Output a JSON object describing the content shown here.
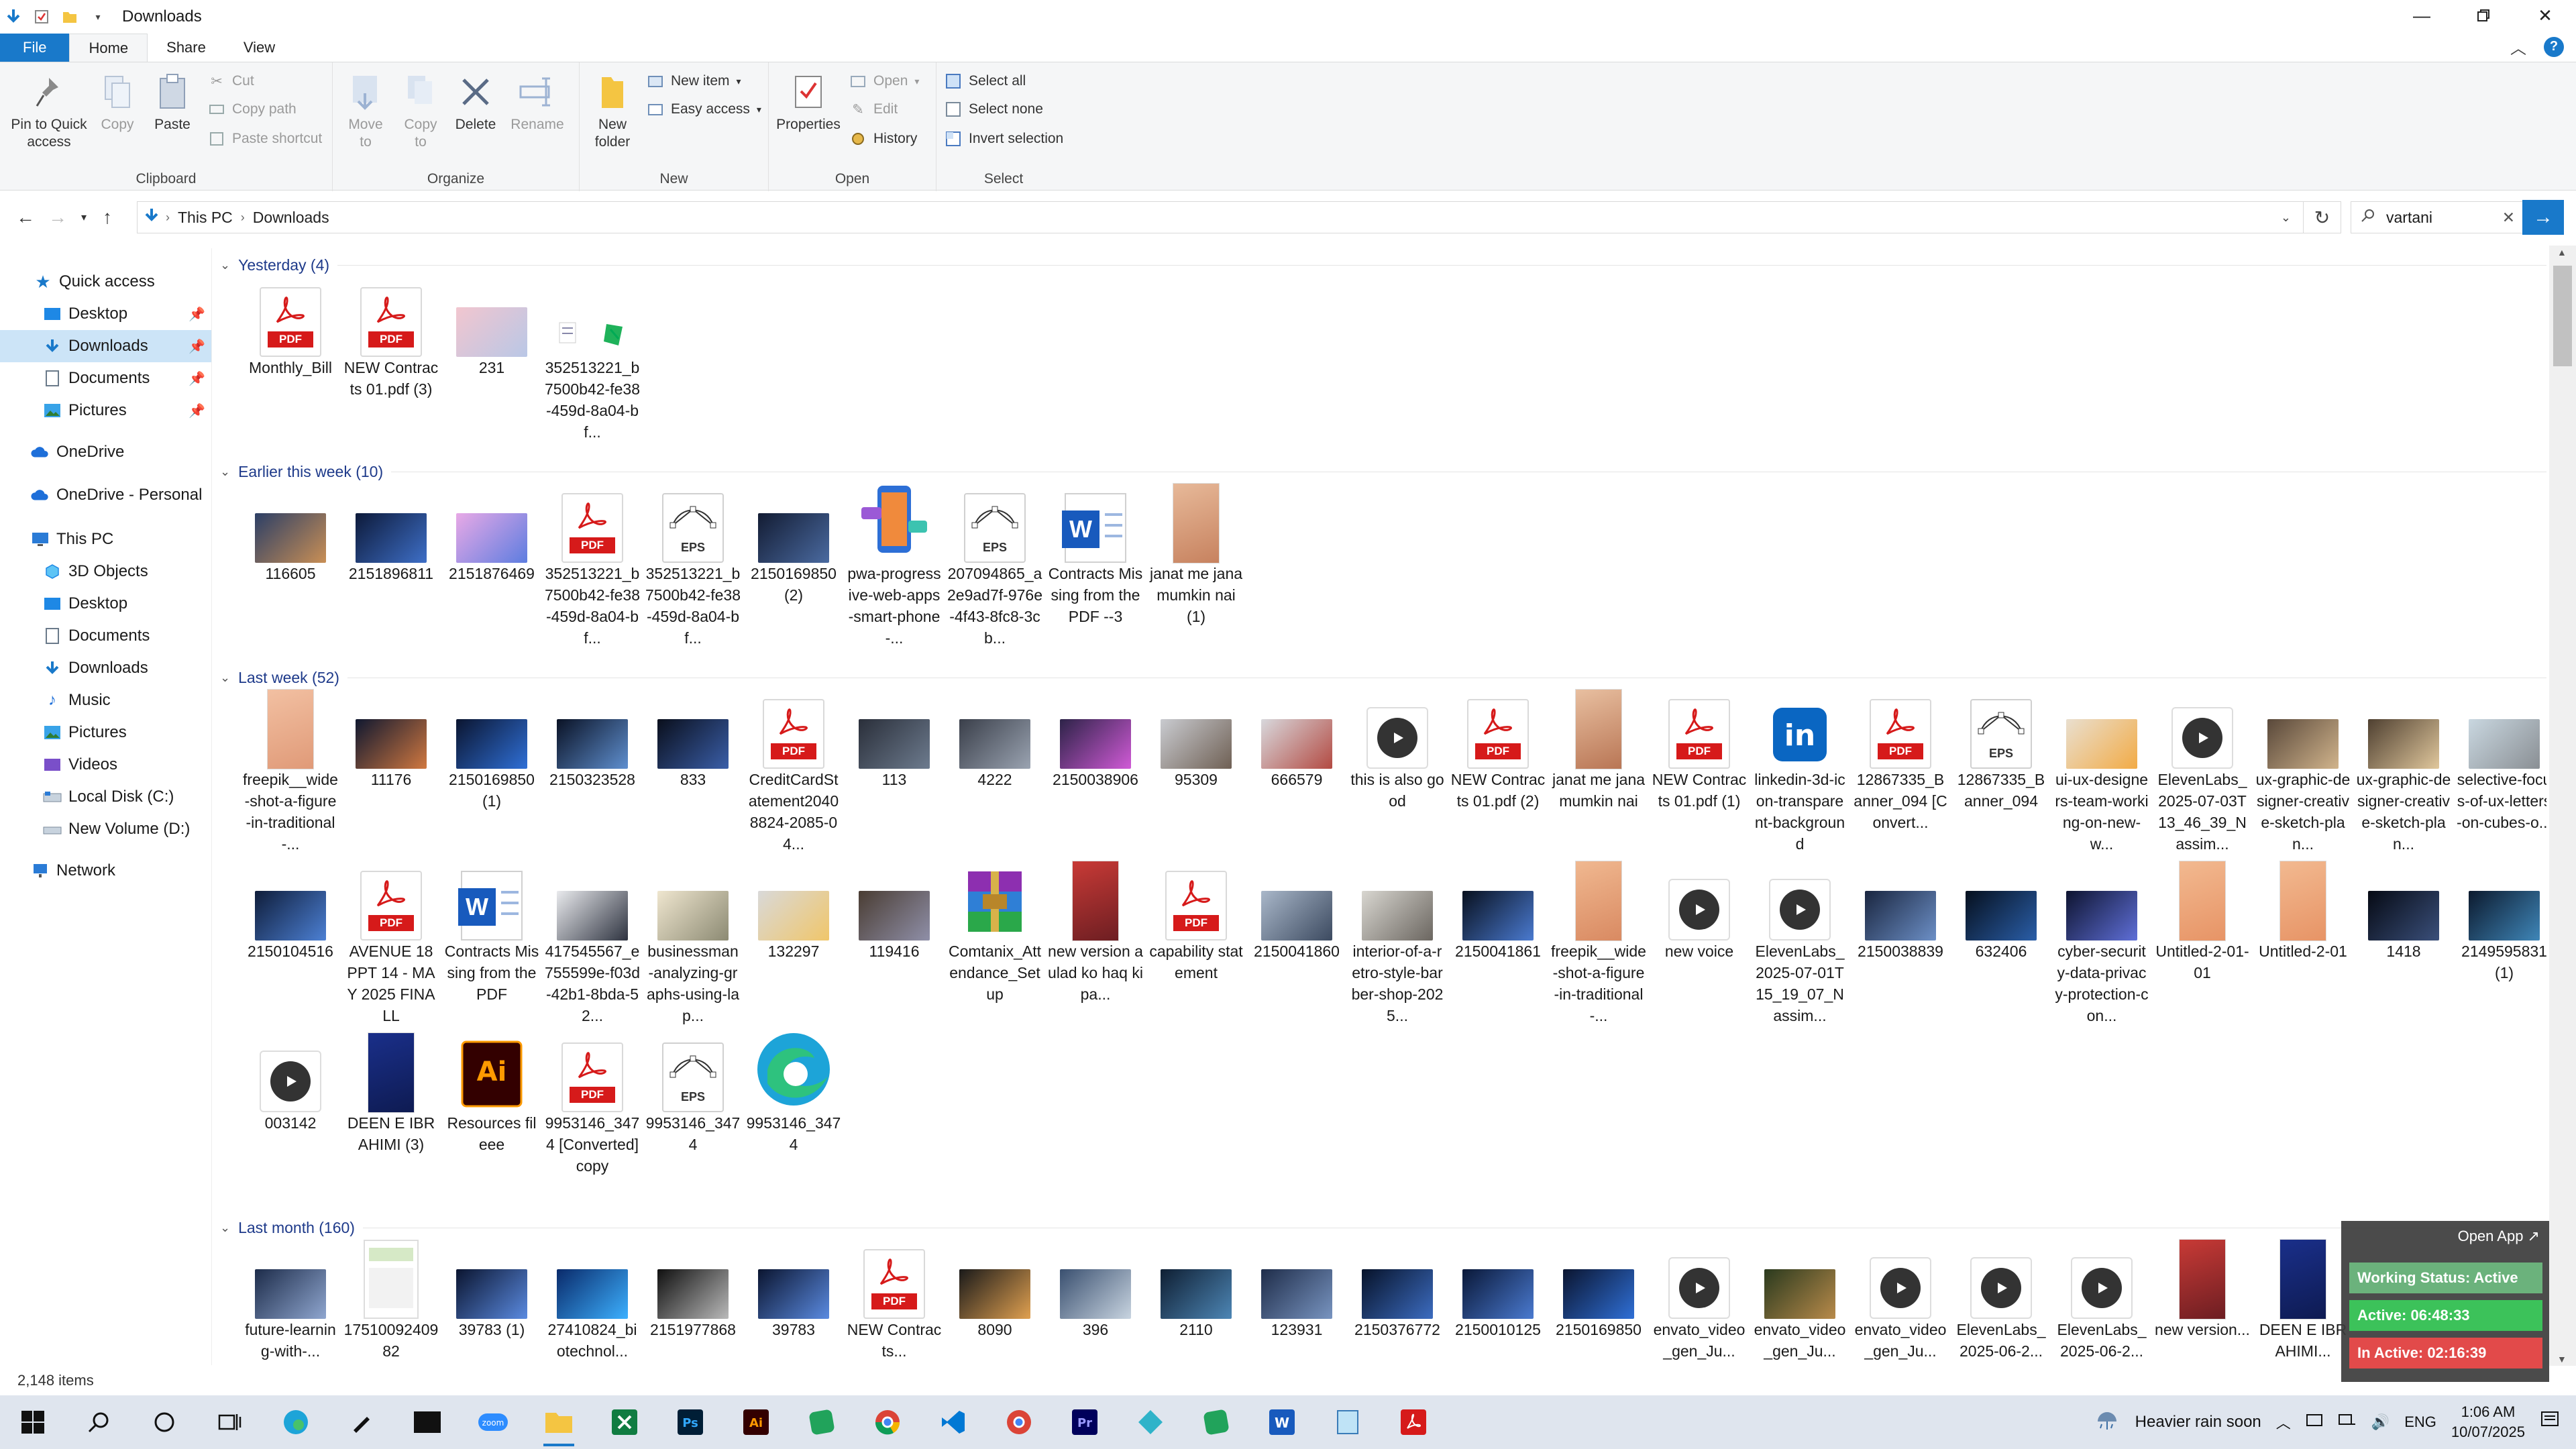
{
  "window": {
    "title": "Downloads"
  },
  "ribbon_tabs": [
    "File",
    "Home",
    "Share",
    "View"
  ],
  "ribbon": {
    "clipboard": {
      "label": "Clipboard",
      "pin": "Pin to Quick access",
      "copy": "Copy",
      "paste": "Paste",
      "cut": "Cut",
      "copy_path": "Copy path",
      "paste_shortcut": "Paste shortcut"
    },
    "organize": {
      "label": "Organize",
      "move_to": "Move to",
      "copy_to": "Copy to",
      "delete": "Delete",
      "rename": "Rename"
    },
    "new": {
      "label": "New",
      "new_folder": "New folder",
      "new_item": "New item",
      "easy_access": "Easy access"
    },
    "open": {
      "label": "Open",
      "properties": "Properties",
      "open": "Open",
      "edit": "Edit",
      "history": "History"
    },
    "select": {
      "label": "Select",
      "select_all": "Select all",
      "select_none": "Select none",
      "invert": "Invert selection"
    }
  },
  "address": {
    "path": [
      "This PC",
      "Downloads"
    ],
    "search_value": "vartani"
  },
  "nav": {
    "quick_access": "Quick access",
    "quick_items": [
      "Desktop",
      "Downloads",
      "Documents",
      "Pictures"
    ],
    "onedrive": "OneDrive",
    "onedrive_personal": "OneDrive - Personal",
    "this_pc": "This PC",
    "pc_items": [
      "3D Objects",
      "Desktop",
      "Documents",
      "Downloads",
      "Music",
      "Pictures",
      "Videos",
      "Local Disk (C:)",
      "New Volume (D:)"
    ],
    "network": "Network"
  },
  "groups": [
    {
      "title": "Yesterday (4)",
      "rows": [
        [
          {
            "kind": "pdf",
            "label": "Monthly_Bill"
          },
          {
            "kind": "pdf",
            "label": "NEW Contracts 01.pdf (3)"
          },
          {
            "kind": "photo",
            "c1": "#f2c6cf",
            "c2": "#b9c7e6",
            "label": "231"
          },
          {
            "kind": "sheet",
            "label": "352513221_b7500b42-fe38-459d-8a04-bf..."
          }
        ]
      ]
    },
    {
      "title": "Earlier this week (10)",
      "rows": [
        [
          {
            "kind": "photo",
            "c1": "#2c3f66",
            "c2": "#c98f55",
            "label": "116605"
          },
          {
            "kind": "photo",
            "c1": "#0d1a3a",
            "c2": "#3e6fc7",
            "label": "2151896811"
          },
          {
            "kind": "photo",
            "c1": "#e8a9e6",
            "c2": "#5d7de0",
            "label": "2151876469"
          },
          {
            "kind": "pdf",
            "label": "352513221_b7500b42-fe38-459d-8a04-bf..."
          },
          {
            "kind": "eps",
            "label": "352513221_b7500b42-fe38-459d-8a04-bf..."
          },
          {
            "kind": "photo",
            "c1": "#131c33",
            "c2": "#4a6aa0",
            "label": "2150169850 (2)"
          },
          {
            "kind": "phone",
            "label": "pwa-progressive-web-apps-smart-phone-..."
          },
          {
            "kind": "eps",
            "label": "207094865_a2e9ad7f-976e-4f43-8fc8-3cb..."
          },
          {
            "kind": "word",
            "label": "Contracts Missing from the PDF --3"
          },
          {
            "kind": "book",
            "c1": "#e7b999",
            "c2": "#c7825f",
            "label": "janat me jana mumkin nai (1)"
          }
        ]
      ]
    },
    {
      "title": "Last week (52)",
      "rows": [
        [
          {
            "kind": "book",
            "c1": "#f2c0a2",
            "c2": "#e09a78",
            "label": "freepik__wide-shot-a-figure-in-traditional-..."
          },
          {
            "kind": "photo",
            "c1": "#101830",
            "c2": "#d07840",
            "label": "11176"
          },
          {
            "kind": "photo",
            "c1": "#0b1530",
            "c2": "#2f6fd6",
            "label": "2150169850 (1)"
          },
          {
            "kind": "photo",
            "c1": "#0a1225",
            "c2": "#5f8fcf",
            "label": "2150323528"
          },
          {
            "kind": "photo",
            "c1": "#0a0f1c",
            "c2": "#3a5ea8",
            "label": "833"
          },
          {
            "kind": "pdf",
            "label": "CreditCardStatement20408824-2085-04..."
          },
          {
            "kind": "photo",
            "c1": "#2a2f3a",
            "c2": "#6d7b8e",
            "label": "113"
          },
          {
            "kind": "photo",
            "c1": "#3a3f4a",
            "c2": "#9aa3b1",
            "label": "4222"
          },
          {
            "kind": "photo",
            "c1": "#2d2348",
            "c2": "#d05ad6",
            "label": "2150038906"
          },
          {
            "kind": "photo",
            "c1": "#c9cbd0",
            "c2": "#6f6054",
            "label": "95309"
          },
          {
            "kind": "photo",
            "c1": "#d8d8dc",
            "c2": "#b34a42",
            "label": "666579"
          },
          {
            "kind": "video",
            "label": "this is also good"
          },
          {
            "kind": "pdf",
            "label": "NEW Contracts 01.pdf (2)"
          },
          {
            "kind": "book",
            "c1": "#e8bfa0",
            "c2": "#b97655",
            "label": "janat me jana mumkin nai"
          },
          {
            "kind": "pdf",
            "label": "NEW Contracts 01.pdf (1)"
          },
          {
            "kind": "linkedin",
            "label": "linkedin-3d-icon-transparent-background"
          },
          {
            "kind": "pdf",
            "label": "12867335_Banner_094 [Convert..."
          },
          {
            "kind": "eps",
            "label": "12867335_Banner_094"
          },
          {
            "kind": "photo",
            "c1": "#e9dfcf",
            "c2": "#f2ab46",
            "label": "ui-ux-designers-team-working-on-new-w..."
          },
          {
            "kind": "video",
            "label": "ElevenLabs_2025-07-03T13_46_39_Nassim..."
          },
          {
            "kind": "photo",
            "c1": "#59483a",
            "c2": "#d1b48c",
            "label": "ux-graphic-designer-creative-sketch-plan..."
          },
          {
            "kind": "photo",
            "c1": "#4f4031",
            "c2": "#e0c79c",
            "label": "ux-graphic-designer-creative-sketch-plan..."
          },
          {
            "kind": "photo",
            "c1": "#c9d7e0",
            "c2": "#8a8f94",
            "label": "selective-focus-of-ux-letters-on-cubes-o..."
          }
        ],
        [
          {
            "kind": "photo",
            "c1": "#0f1d3a",
            "c2": "#4c80d4",
            "label": "2150104516"
          },
          {
            "kind": "pdf",
            "label": "AVENUE 18 PPT 14 - MAY 2025 FINALL"
          },
          {
            "kind": "word",
            "label": "Contracts Missing from the PDF"
          },
          {
            "kind": "photo",
            "c1": "#e9eaed",
            "c2": "#2e3340",
            "label": "417545567_e755599e-f03d-42b1-8bda-52..."
          },
          {
            "kind": "photo",
            "c1": "#efe6cf",
            "c2": "#8c8a73",
            "label": "businessman-analyzing-graphs-using-lap..."
          },
          {
            "kind": "photo",
            "c1": "#d9d9d9",
            "c2": "#f0c66a",
            "label": "132297"
          },
          {
            "kind": "photo",
            "c1": "#4a3d33",
            "c2": "#8f8fa8",
            "label": "119416"
          },
          {
            "kind": "rar",
            "label": "Comtanix_Attendance_Setup"
          },
          {
            "kind": "book",
            "c1": "#c83a36",
            "c2": "#6d1e22",
            "label": "new version aulad ko haq ki pa..."
          },
          {
            "kind": "pdf",
            "label": "capability statement"
          },
          {
            "kind": "photo",
            "c1": "#a9b7c9",
            "c2": "#3c4a60",
            "label": "2150041860"
          },
          {
            "kind": "photo",
            "c1": "#d8d6d0",
            "c2": "#6b6660",
            "label": "interior-of-a-retro-style-barber-shop-2025..."
          },
          {
            "kind": "photo",
            "c1": "#08101e",
            "c2": "#4a7ad0",
            "label": "2150041861"
          },
          {
            "kind": "book",
            "c1": "#f0b890",
            "c2": "#d98a62",
            "label": "freepik__wide-shot-a-figure-in-traditional-..."
          },
          {
            "kind": "video",
            "label": "new voice"
          },
          {
            "kind": "video",
            "label": "ElevenLabs_2025-07-01T15_19_07_Nassim..."
          },
          {
            "kind": "photo",
            "c1": "#1a2640",
            "c2": "#6c8fc6",
            "label": "2150038839"
          },
          {
            "kind": "photo",
            "c1": "#06101e",
            "c2": "#2a5ea8",
            "label": "632406"
          },
          {
            "kind": "photo",
            "c1": "#0e1430",
            "c2": "#5f6fd8",
            "label": "cyber-security-data-privacy-protection-con..."
          },
          {
            "kind": "book",
            "c1": "#f2b990",
            "c2": "#e79466",
            "label": "Untitled-2-01-01"
          },
          {
            "kind": "book",
            "c1": "#f2b990",
            "c2": "#e79466",
            "label": "Untitled-2-01"
          },
          {
            "kind": "photo",
            "c1": "#060a14",
            "c2": "#3a4f7a",
            "label": "1418"
          },
          {
            "kind": "photo",
            "c1": "#0c1a2e",
            "c2": "#3f86b8",
            "label": "2149595831 (1)"
          }
        ],
        [
          {
            "kind": "video",
            "label": "003142"
          },
          {
            "kind": "book",
            "c1": "#1a2f8a",
            "c2": "#0e1b52",
            "label": "DEEN E IBRAHIMI (3)"
          },
          {
            "kind": "ai",
            "label": "Resources fileee"
          },
          {
            "kind": "pdf",
            "label": "9953146_3474 [Converted] copy"
          },
          {
            "kind": "eps",
            "label": "9953146_3474"
          },
          {
            "kind": "edge",
            "label": "9953146_3474"
          }
        ]
      ]
    },
    {
      "title": "Last month (160)",
      "rows": [
        [
          {
            "kind": "photo",
            "c1": "#1d2c4a",
            "c2": "#8fa6cf",
            "label": "future-learning-with-..."
          },
          {
            "kind": "phone2",
            "label": "1751009240982"
          },
          {
            "kind": "photo",
            "c1": "#0b1530",
            "c2": "#5a8ae0",
            "label": "39783 (1)"
          },
          {
            "kind": "photo",
            "c1": "#0a2a6a",
            "c2": "#3cb0ff",
            "label": "27410824_biotechnol..."
          },
          {
            "kind": "photo",
            "c1": "#101010",
            "c2": "#b9b9b9",
            "label": "2151977868"
          },
          {
            "kind": "photo",
            "c1": "#0b1530",
            "c2": "#5a8ae0",
            "label": "39783"
          },
          {
            "kind": "pdf",
            "label": "NEW Contracts..."
          },
          {
            "kind": "photo",
            "c1": "#1a1a1a",
            "c2": "#e0a050",
            "label": "8090"
          },
          {
            "kind": "photo",
            "c1": "#3a5070",
            "c2": "#c8d4e0",
            "label": "396"
          },
          {
            "kind": "photo",
            "c1": "#0f1f33",
            "c2": "#4d86b5",
            "label": "2110"
          },
          {
            "kind": "photo",
            "c1": "#1f2d4a",
            "c2": "#7894c0",
            "label": "123931"
          },
          {
            "kind": "photo",
            "c1": "#07132a",
            "c2": "#3c6cc0",
            "label": "2150376772"
          },
          {
            "kind": "photo",
            "c1": "#0a1838",
            "c2": "#4a7ad0",
            "label": "2150010125"
          },
          {
            "kind": "photo",
            "c1": "#0b1530",
            "c2": "#2f6fd6",
            "label": "2150169850"
          },
          {
            "kind": "video",
            "label": "envato_video_gen_Ju..."
          },
          {
            "kind": "photo",
            "c1": "#2a3a1e",
            "c2": "#b88a4a",
            "label": "envato_video_gen_Ju..."
          },
          {
            "kind": "video",
            "label": "envato_video_gen_Ju..."
          },
          {
            "kind": "video",
            "label": "ElevenLabs_2025-06-2..."
          },
          {
            "kind": "video",
            "label": "ElevenLabs_2025-06-2..."
          },
          {
            "kind": "book",
            "c1": "#c83a36",
            "c2": "#6d1e22",
            "label": "new version..."
          },
          {
            "kind": "book",
            "c1": "#1a2f8a",
            "c2": "#0e1b52",
            "label": "DEEN E IBRAHIMI..."
          }
        ]
      ]
    }
  ],
  "status": {
    "items": "2,148 items"
  },
  "widget": {
    "open_app": "Open App ↗",
    "working": "Working Status: Active",
    "active": "Active: 06:48:33",
    "inactive": "In Active: 02:16:39"
  },
  "taskbar": {
    "weather": "Heavier rain soon",
    "lang": "ENG",
    "time": "1:06 AM",
    "date": "10/07/2025"
  },
  "colors": {
    "accent": "#1979ca",
    "selected": "#cce4f7",
    "pdf_red": "#d61a1a"
  }
}
